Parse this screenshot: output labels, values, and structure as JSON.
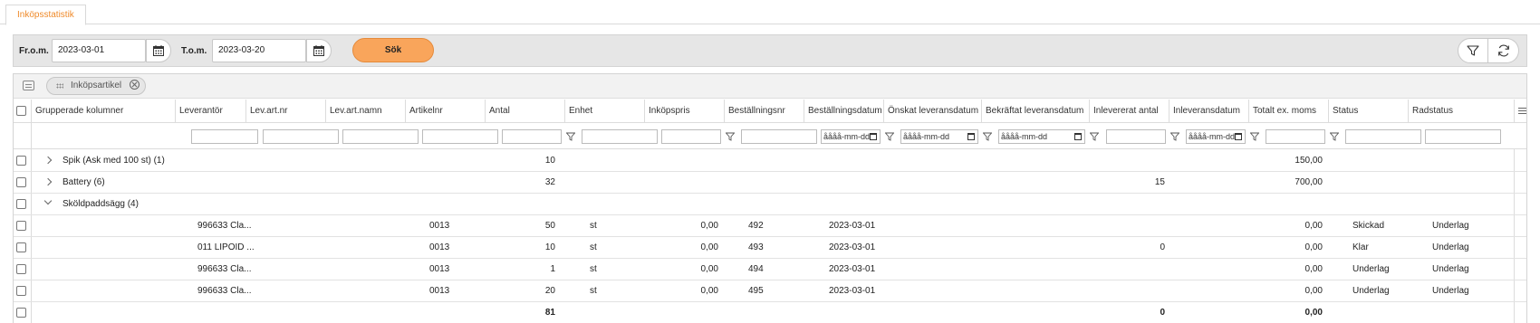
{
  "tab": {
    "label": "Inköpsstatistik"
  },
  "filter": {
    "from_label": "Fr.o.m.",
    "from_value": "2023-03-01",
    "to_label": "T.o.m.",
    "to_value": "2023-03-20",
    "search_label": "Sök"
  },
  "group_panel": {
    "chip_label": "Inköpsartikel"
  },
  "columns": [
    "Grupperade kolumner",
    "Leverantör",
    "Lev.art.nr",
    "Lev.art.namn",
    "Artikelnr",
    "Antal",
    "Enhet",
    "Inköpspris",
    "Beställningsnr",
    "Beställningsdatum",
    "Önskat leveransdatum",
    "Bekräftat leveransdatum",
    "Inlevererat antal",
    "Inleveransdatum",
    "Totalt ex. moms",
    "Status",
    "Radstatus"
  ],
  "date_placeholder": "åååå-mm-dd",
  "groups": [
    {
      "label": "Spik (Ask med 100 st) (1)",
      "antal": "10",
      "inlevererat": "",
      "totalt": "150,00"
    },
    {
      "label": "Battery (6)",
      "antal": "32",
      "inlevererat": "15",
      "totalt": "700,00"
    },
    {
      "label": "Sköldpaddsägg (4)"
    }
  ],
  "rows": [
    {
      "leverantor": "996633 Cla...",
      "artikelnr": "0013",
      "antal": "50",
      "enhet": "st",
      "pris": "0,00",
      "bestnr": "492",
      "bestdatum": "2023-03-01",
      "inlevererat": "",
      "totalt": "0,00",
      "status": "Skickad",
      "radstatus": "Underlag"
    },
    {
      "leverantor": "011 LIPOID ...",
      "artikelnr": "0013",
      "antal": "10",
      "enhet": "st",
      "pris": "0,00",
      "bestnr": "493",
      "bestdatum": "2023-03-01",
      "inlevererat": "0",
      "totalt": "0,00",
      "status": "Klar",
      "radstatus": "Underlag"
    },
    {
      "leverantor": "996633 Cla...",
      "artikelnr": "0013",
      "antal": "1",
      "enhet": "st",
      "pris": "0,00",
      "bestnr": "494",
      "bestdatum": "2023-03-01",
      "inlevererat": "",
      "totalt": "0,00",
      "status": "Underlag",
      "radstatus": "Underlag"
    },
    {
      "leverantor": "996633 Cla...",
      "artikelnr": "0013",
      "antal": "20",
      "enhet": "st",
      "pris": "0,00",
      "bestnr": "495",
      "bestdatum": "2023-03-01",
      "inlevererat": "",
      "totalt": "0,00",
      "status": "Underlag",
      "radstatus": "Underlag"
    }
  ],
  "totals": {
    "antal": "81",
    "inlevererat": "0",
    "totalt": "0,00"
  },
  "colors": {
    "accent": "#ef8a2a",
    "search_button": "#f9a55b"
  }
}
